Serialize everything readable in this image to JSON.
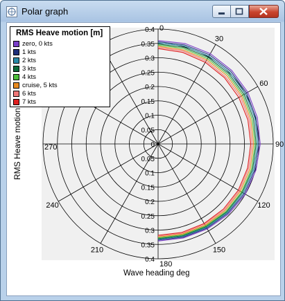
{
  "window": {
    "title": "Polar graph"
  },
  "chart_data": {
    "type": "polar-line",
    "title": "RMS Heave motion [m]",
    "radial_axis_label": "RMS Heave motion [m]",
    "angular_axis_label": "Wave heading  deg",
    "radial_range": [
      0,
      0.4
    ],
    "radial_ticks": [
      "0",
      "0.05",
      "0.1",
      "0.15",
      "0.2",
      "0.25",
      "0.3",
      "0.35",
      "0.4"
    ],
    "angle_ticks": [
      "0",
      "30",
      "60",
      "90",
      "120",
      "150",
      "180",
      "210",
      "240",
      "270"
    ],
    "grid": true,
    "legend_position": "top-left",
    "angles_deg": [
      0,
      15,
      30,
      45,
      60,
      75,
      90,
      105,
      120,
      135,
      150,
      165,
      180
    ],
    "series": [
      {
        "name": "zero, 0 kts",
        "color": "#7a3fc8",
        "values": [
          0.36,
          0.362,
          0.363,
          0.362,
          0.36,
          0.357,
          0.355,
          0.352,
          0.35,
          0.346,
          0.342,
          0.339,
          0.338
        ]
      },
      {
        "name": "1 kts",
        "color": "#1e2f7a",
        "values": [
          0.356,
          0.357,
          0.358,
          0.357,
          0.355,
          0.352,
          0.35,
          0.348,
          0.346,
          0.342,
          0.339,
          0.336,
          0.335
        ]
      },
      {
        "name": "2 kts",
        "color": "#2a8aa8",
        "values": [
          0.352,
          0.353,
          0.353,
          0.352,
          0.35,
          0.348,
          0.346,
          0.344,
          0.342,
          0.339,
          0.336,
          0.333,
          0.332
        ]
      },
      {
        "name": "3 kts",
        "color": "#0d6b3a",
        "values": [
          0.348,
          0.348,
          0.348,
          0.347,
          0.345,
          0.343,
          0.341,
          0.34,
          0.338,
          0.336,
          0.333,
          0.331,
          0.33
        ]
      },
      {
        "name": "4 kts",
        "color": "#4dbf3a",
        "values": [
          0.344,
          0.344,
          0.343,
          0.342,
          0.34,
          0.338,
          0.337,
          0.336,
          0.335,
          0.333,
          0.33,
          0.328,
          0.327
        ]
      },
      {
        "name": "cruise, 5 kts",
        "color": "#e88a20",
        "values": [
          0.34,
          0.339,
          0.338,
          0.337,
          0.335,
          0.333,
          0.332,
          0.331,
          0.33,
          0.329,
          0.327,
          0.325,
          0.324
        ]
      },
      {
        "name": "6 kts",
        "color": "#f07878",
        "values": [
          0.336,
          0.335,
          0.333,
          0.331,
          0.33,
          0.328,
          0.327,
          0.326,
          0.326,
          0.325,
          0.323,
          0.322,
          0.321
        ]
      },
      {
        "name": "7 kts",
        "color": "#e02020",
        "values": [
          0.332,
          0.33,
          0.328,
          0.326,
          0.324,
          0.323,
          0.322,
          0.322,
          0.322,
          0.321,
          0.32,
          0.319,
          0.318
        ]
      }
    ]
  }
}
